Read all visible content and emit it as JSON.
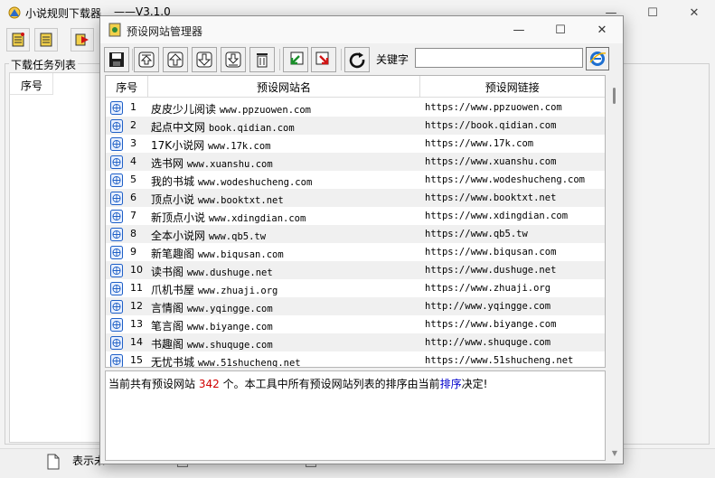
{
  "main_window": {
    "title": "小说规则下载器",
    "version": "——V3.1.0",
    "group_label": "下载任务列表",
    "list_header": "序号",
    "status_text": "表示未..."
  },
  "dialog": {
    "title": "预设网站管理器",
    "keyword_label": "关键字",
    "keyword_value": "",
    "columns": [
      "序号",
      "预设网站名",
      "预设网链接"
    ],
    "rows": [
      {
        "num": "1",
        "name": "皮皮少儿阅读",
        "domain": "www.ppzuowen.com",
        "url": "https://www.ppzuowen.com"
      },
      {
        "num": "2",
        "name": "起点中文网",
        "domain": "book.qidian.com",
        "url": "https://book.qidian.com"
      },
      {
        "num": "3",
        "name": "17K小说网",
        "domain": "www.17k.com",
        "url": "https://www.17k.com"
      },
      {
        "num": "4",
        "name": "选书网",
        "domain": " www.xuanshu.com",
        "url": "https://www.xuanshu.com"
      },
      {
        "num": "5",
        "name": "我的书城",
        "domain": "www.wodeshucheng.com",
        "url": "https://www.wodeshucheng.com"
      },
      {
        "num": "6",
        "name": "顶点小说",
        "domain": "www.booktxt.net",
        "url": "https://www.booktxt.net"
      },
      {
        "num": "7",
        "name": "新顶点小说",
        "domain": "www.xdingdian.com",
        "url": "https://www.xdingdian.com"
      },
      {
        "num": "8",
        "name": "全本小说网",
        "domain": "www.qb5.tw",
        "url": "https://www.qb5.tw"
      },
      {
        "num": "9",
        "name": "新笔趣阁",
        "domain": "www.biqusan.com",
        "url": "https://www.biqusan.com"
      },
      {
        "num": "10",
        "name": "读书阁",
        "domain": "www.dushuge.net",
        "url": "https://www.dushuge.net"
      },
      {
        "num": "11",
        "name": "爪机书屋",
        "domain": "www.zhuaji.org",
        "url": "https://www.zhuaji.org"
      },
      {
        "num": "12",
        "name": "言情阁",
        "domain": "www.yqingge.com",
        "url": "http://www.yqingge.com"
      },
      {
        "num": "13",
        "name": "笔言阁",
        "domain": "www.biyange.com",
        "url": "https://www.biyange.com"
      },
      {
        "num": "14",
        "name": "书趣阁",
        "domain": "www.shuquge.com",
        "url": "http://www.shuquge.com"
      },
      {
        "num": "15",
        "name": "无忧书城",
        "domain": "www.51shucheng.net",
        "url": "https://www.51shucheng.net"
      }
    ],
    "info_prefix": "当前共有预设网站",
    "info_count": "342",
    "info_middle": "个。本工具中所有预设网站列表的排序由当前",
    "info_link": "排序",
    "info_suffix": "决定!"
  },
  "colors": {
    "accent_red": "#d00000",
    "accent_blue": "#0000cc",
    "toolbar_green_arrow": "#1a8f2a",
    "toolbar_red_arrow": "#d01515"
  },
  "icons": [
    "novel-app-icon",
    "minimize-icon",
    "maximize-icon",
    "close-icon",
    "save-icon",
    "move-top-icon",
    "move-up-icon",
    "move-down-icon",
    "move-bottom-icon",
    "delete-icon",
    "import-icon",
    "export-icon",
    "refresh-icon",
    "ie-browser-icon",
    "site-page-icon"
  ]
}
